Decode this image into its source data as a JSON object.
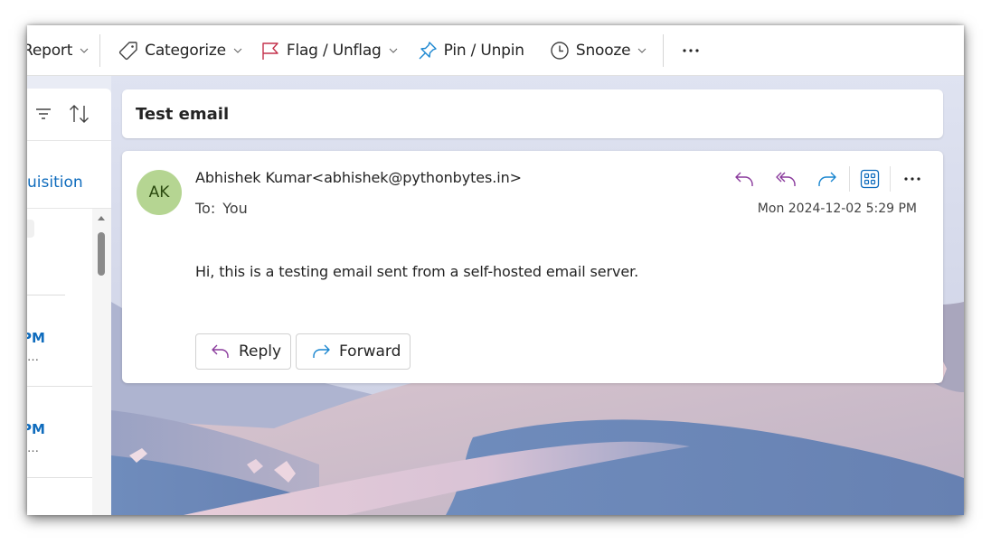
{
  "ribbon": {
    "items": [
      {
        "label": "Report",
        "icon": "report-icon",
        "has_dropdown": true
      },
      {
        "label": "Categorize",
        "icon": "tag-icon",
        "has_dropdown": true
      },
      {
        "label": "Flag / Unflag",
        "icon": "flag-icon",
        "has_dropdown": true
      },
      {
        "label": "Pin / Unpin",
        "icon": "pin-icon",
        "has_dropdown": false
      },
      {
        "label": "Snooze",
        "icon": "clock-icon",
        "has_dropdown": true
      }
    ],
    "more_icon": "more-horizontal-icon"
  },
  "message_list": {
    "filter_icon": "filter-icon",
    "sort_icon": "sort-icon",
    "folder_title": "uisition",
    "items": [
      {
        "time": "PM",
        "preview": "…"
      },
      {
        "time": "PM",
        "preview": "…"
      }
    ]
  },
  "reading_pane": {
    "subject": "Test email",
    "message": {
      "avatar_initials": "AK",
      "avatar_color": "#b5d592",
      "sender": "Abhishek Kumar<abhishek@pythonbytes.in>",
      "to_label": "To:",
      "to_value": "You",
      "timestamp": "Mon 2024-12-02 5:29 PM",
      "body": "Hi, this is a testing email sent from a self-hosted email server.",
      "actions": [
        {
          "name": "reply",
          "icon": "reply-icon"
        },
        {
          "name": "reply-all",
          "icon": "reply-all-icon"
        },
        {
          "name": "forward",
          "icon": "forward-icon"
        },
        {
          "name": "apps",
          "icon": "apps-icon"
        },
        {
          "name": "more",
          "icon": "more-horizontal-icon"
        }
      ],
      "reply_label": "Reply",
      "forward_label": "Forward"
    }
  },
  "colors": {
    "accent_blue": "#0f6cbd",
    "reply_purple": "#8a3a9c",
    "forward_blue": "#1a86d0",
    "flag_red": "#c4314b"
  }
}
